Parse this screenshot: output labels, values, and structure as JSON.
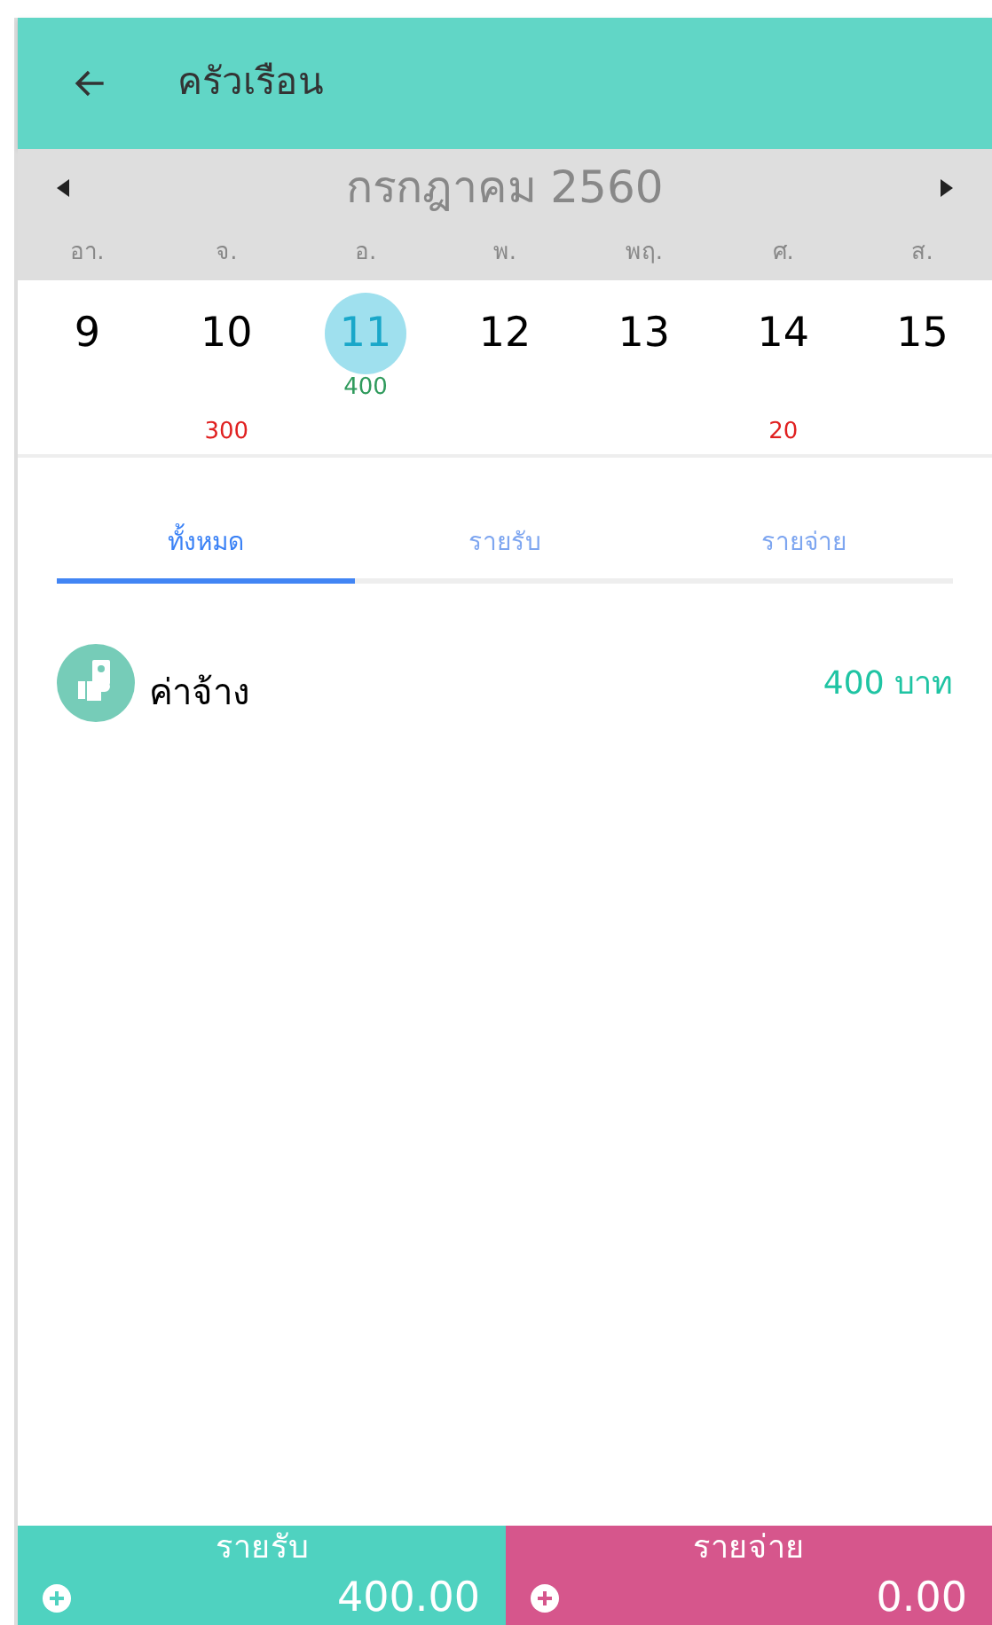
{
  "header": {
    "title": "ครัวเรือน"
  },
  "calendar": {
    "month": "กรกฎาคม 2560",
    "days": [
      {
        "weekday": "อา.",
        "date": "9",
        "selected": false
      },
      {
        "weekday": "จ.",
        "date": "10",
        "selected": false,
        "expense": "300"
      },
      {
        "weekday": "อ.",
        "date": "11",
        "selected": true,
        "income": "400"
      },
      {
        "weekday": "พ.",
        "date": "12",
        "selected": false
      },
      {
        "weekday": "พฤ.",
        "date": "13",
        "selected": false
      },
      {
        "weekday": "ศ.",
        "date": "14",
        "selected": false,
        "expense": "20"
      },
      {
        "weekday": "ส.",
        "date": "15",
        "selected": false
      }
    ]
  },
  "tabs": [
    {
      "label": "ทั้งหมด",
      "selected": true
    },
    {
      "label": "รายรับ",
      "selected": false
    },
    {
      "label": "รายจ่าย",
      "selected": false
    }
  ],
  "entries": [
    {
      "name": "ค่าจ้าง",
      "amount": "400 บาท"
    }
  ],
  "totals": [
    {
      "kind": "income",
      "label": "รายรับ",
      "value": "400.00"
    },
    {
      "kind": "expense",
      "label": "รายจ่าย",
      "value": "0.00"
    }
  ]
}
